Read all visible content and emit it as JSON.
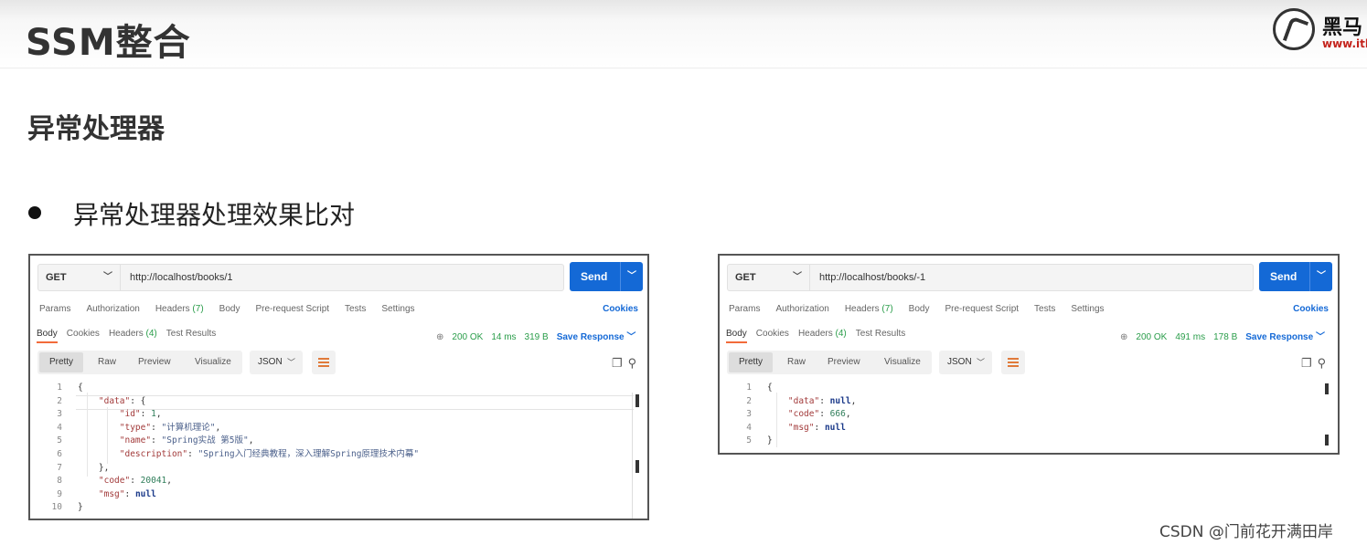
{
  "slide": {
    "title": "SSM整合",
    "logo": {
      "cn": "黑马",
      "url": "www.ith"
    },
    "section_title": "异常处理器",
    "bullet": "异常处理器处理效果比对"
  },
  "tabs": {
    "request": [
      "Params",
      "Authorization",
      "Headers",
      "Body",
      "Pre-request Script",
      "Tests",
      "Settings"
    ],
    "headers_count": "(7)",
    "cookies": "Cookies",
    "response": {
      "body": "Body",
      "cookies": "Cookies",
      "headers": "Headers",
      "headers_count": "(4)",
      "tests": "Test Results"
    },
    "views": [
      "Pretty",
      "Raw",
      "Preview",
      "Visualize"
    ],
    "format": "JSON",
    "send": "Send",
    "save_response": "Save Response"
  },
  "left": {
    "method": "GET",
    "url": "http://localhost/books/1",
    "status": "200 OK",
    "time": "14 ms",
    "size": "319 B",
    "line_numbers": [
      "1",
      "2",
      "3",
      "4",
      "5",
      "6",
      "7",
      "8",
      "9",
      "10"
    ],
    "code": {
      "l1": "{",
      "data_key": "\"data\"",
      "l2_tail": ": {",
      "id_key": "\"id\"",
      "id_val": "1",
      "type_key": "\"type\"",
      "type_val": "\"计算机理论\"",
      "name_key": "\"name\"",
      "name_val": "\"Spring实战 第5版\"",
      "desc_key": "\"description\"",
      "desc_val": "\"Spring入门经典教程，深入理解Spring原理技术内幕\"",
      "l7": "},",
      "code_key": "\"code\"",
      "code_val": "20041",
      "msg_key": "\"msg\"",
      "msg_val": "null",
      "l10": "}"
    }
  },
  "right": {
    "method": "GET",
    "url": "http://localhost/books/-1",
    "status": "200 OK",
    "time": "491 ms",
    "size": "178 B",
    "line_numbers": [
      "1",
      "2",
      "3",
      "4",
      "5"
    ],
    "code": {
      "l1": "{",
      "data_key": "\"data\"",
      "data_val": "null",
      "code_key": "\"code\"",
      "code_val": "666",
      "msg_key": "\"msg\"",
      "msg_val": "null",
      "l5": "}"
    }
  },
  "watermark": "CSDN @门前花开满田岸",
  "colors": {
    "send": "#1469d6",
    "status_green": "#2a9d4a",
    "active_tab_underline": "#f26b3a",
    "logo_red": "#c4231c"
  },
  "icons": {
    "globe": "globe-icon",
    "copy": "copy-icon",
    "search": "search-icon",
    "wrap": "wrap-lines-icon"
  }
}
